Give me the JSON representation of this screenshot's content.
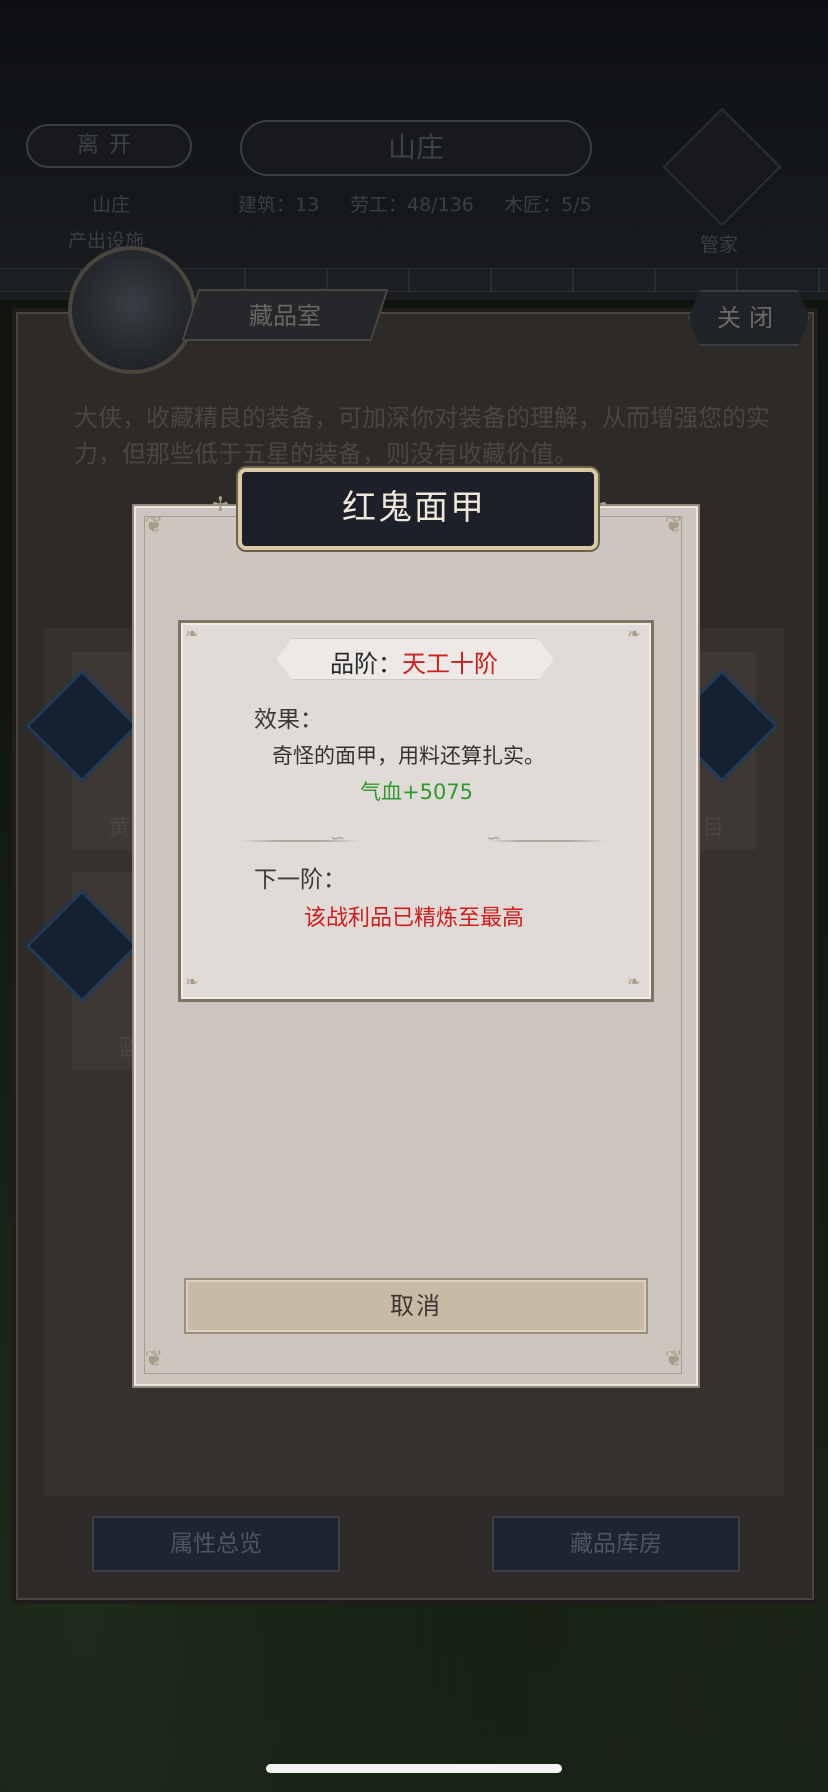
{
  "background": {
    "leave_button": "离开",
    "location_title": "山庄",
    "location_sub": "山庄",
    "location_sub2": "产出设施",
    "stats": [
      {
        "label": "建筑",
        "value": "13"
      },
      {
        "label": "劳工",
        "value": "48/136"
      },
      {
        "label": "木匠",
        "value": "5/5"
      }
    ],
    "housekeeper_label": "管家",
    "panel_title": "藏品室",
    "close_button": "关闭",
    "panel_intro": "大侠，收藏精良的装备，可加深你对装备的理解，从而增强您的实力，但那些低于五星的装备，则没有收藏价值。",
    "cards": [
      {
        "label": "黄",
        "side": "left"
      },
      {
        "label": "面目",
        "side": "right"
      },
      {
        "label": "蓝",
        "side": "left"
      }
    ],
    "bottom_buttons": {
      "left": "属性总览",
      "right": "藏品库房"
    }
  },
  "dialog": {
    "title": "红鬼面甲",
    "grade_label": "品阶：",
    "grade_value": "天工十阶",
    "effect_label": "效果：",
    "description": "奇怪的面甲，用料还算扎实。",
    "stat": "气血+5075",
    "next_label": "下一阶：",
    "max_note": "该战利品已精炼至最高",
    "cancel_button": "取消"
  },
  "colors": {
    "grade_red": "#d21c1c",
    "stat_green": "#2e9a2e",
    "dialog_bg": "#cdc6c0",
    "title_plate": "#1d2029"
  }
}
